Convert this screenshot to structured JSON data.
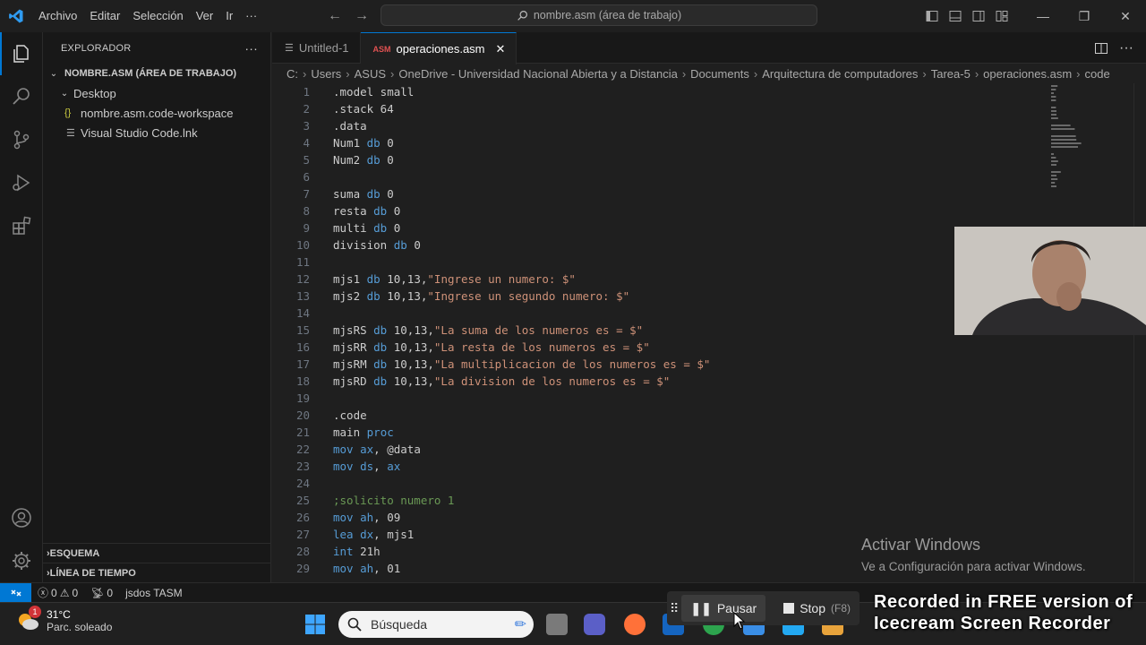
{
  "titlebar": {
    "menu": [
      "Archivo",
      "Editar",
      "Selección",
      "Ver",
      "Ir",
      "···"
    ],
    "search": "nombre.asm (área de trabajo)"
  },
  "sidebar": {
    "title": "EXPLORADOR",
    "more": "···",
    "workspace": "NOMBRE.ASM (ÁREA DE TRABAJO)",
    "folder": "Desktop",
    "files": [
      {
        "icon": "{}",
        "name": "nombre.asm.code-workspace"
      },
      {
        "icon": "",
        "name": "Visual Studio Code.lnk"
      }
    ],
    "outline": "ESQUEMA",
    "timeline": "LÍNEA DE TIEMPO"
  },
  "tabs": [
    {
      "label": "Untitled-1"
    },
    {
      "label": "operaciones.asm",
      "icon": "ASM"
    }
  ],
  "breadcrumb": [
    "C:",
    "Users",
    "ASUS",
    "OneDrive - Universidad Nacional Abierta y a Distancia",
    "Documents",
    "Arquitectura de computadores",
    "Tarea-5",
    "operaciones.asm",
    "code"
  ],
  "code": {
    "lines": [
      {
        "n": "1",
        "parts": [
          [
            "t",
            ".model small"
          ]
        ]
      },
      {
        "n": "2",
        "parts": [
          [
            "t",
            ".stack 64"
          ]
        ]
      },
      {
        "n": "3",
        "parts": [
          [
            "t",
            ".data"
          ]
        ]
      },
      {
        "n": "4",
        "parts": [
          [
            "t",
            "Num1 "
          ],
          [
            "kw",
            "db"
          ],
          [
            "t",
            " 0"
          ]
        ]
      },
      {
        "n": "5",
        "parts": [
          [
            "t",
            "Num2 "
          ],
          [
            "kw",
            "db"
          ],
          [
            "t",
            " 0"
          ]
        ]
      },
      {
        "n": "6",
        "parts": []
      },
      {
        "n": "7",
        "parts": [
          [
            "t",
            "suma "
          ],
          [
            "kw",
            "db"
          ],
          [
            "t",
            " 0"
          ]
        ]
      },
      {
        "n": "8",
        "parts": [
          [
            "t",
            "resta "
          ],
          [
            "kw",
            "db"
          ],
          [
            "t",
            " 0"
          ]
        ]
      },
      {
        "n": "9",
        "parts": [
          [
            "t",
            "multi "
          ],
          [
            "kw",
            "db"
          ],
          [
            "t",
            " 0"
          ]
        ]
      },
      {
        "n": "10",
        "parts": [
          [
            "t",
            "division "
          ],
          [
            "kw",
            "db"
          ],
          [
            "t",
            " 0"
          ]
        ]
      },
      {
        "n": "11",
        "parts": []
      },
      {
        "n": "12",
        "parts": [
          [
            "t",
            "mjs1 "
          ],
          [
            "kw",
            "db"
          ],
          [
            "t",
            " 10,13,"
          ],
          [
            "str",
            "\"Ingrese un numero: $\""
          ]
        ]
      },
      {
        "n": "13",
        "parts": [
          [
            "t",
            "mjs2 "
          ],
          [
            "kw",
            "db"
          ],
          [
            "t",
            " 10,13,"
          ],
          [
            "str",
            "\"Ingrese un segundo numero: $\""
          ]
        ]
      },
      {
        "n": "14",
        "parts": []
      },
      {
        "n": "15",
        "parts": [
          [
            "t",
            "mjsRS "
          ],
          [
            "kw",
            "db"
          ],
          [
            "t",
            " 10,13,"
          ],
          [
            "str",
            "\"La suma de los numeros es = $\""
          ]
        ]
      },
      {
        "n": "16",
        "parts": [
          [
            "t",
            "mjsRR "
          ],
          [
            "kw",
            "db"
          ],
          [
            "t",
            " 10,13,"
          ],
          [
            "str",
            "\"La resta de los numeros es = $\""
          ]
        ]
      },
      {
        "n": "17",
        "parts": [
          [
            "t",
            "mjsRM "
          ],
          [
            "kw",
            "db"
          ],
          [
            "t",
            " 10,13,"
          ],
          [
            "str",
            "\"La multiplicacion de los numeros es = $\""
          ]
        ]
      },
      {
        "n": "18",
        "parts": [
          [
            "t",
            "mjsRD "
          ],
          [
            "kw",
            "db"
          ],
          [
            "t",
            " 10,13,"
          ],
          [
            "str",
            "\"La division de los numeros es = $\""
          ]
        ]
      },
      {
        "n": "19",
        "parts": []
      },
      {
        "n": "20",
        "parts": [
          [
            "t",
            ".code"
          ]
        ]
      },
      {
        "n": "21",
        "parts": [
          [
            "t",
            "main "
          ],
          [
            "kw",
            "proc"
          ]
        ]
      },
      {
        "n": "22",
        "parts": [
          [
            "kw",
            "mov"
          ],
          [
            "t",
            " "
          ],
          [
            "kw",
            "ax"
          ],
          [
            "t",
            ", @data"
          ]
        ]
      },
      {
        "n": "23",
        "parts": [
          [
            "kw",
            "mov"
          ],
          [
            "t",
            " "
          ],
          [
            "kw",
            "ds"
          ],
          [
            "t",
            ", "
          ],
          [
            "kw",
            "ax"
          ]
        ]
      },
      {
        "n": "24",
        "parts": []
      },
      {
        "n": "25",
        "parts": [
          [
            "com",
            ";solicito numero 1"
          ]
        ]
      },
      {
        "n": "26",
        "parts": [
          [
            "kw",
            "mov"
          ],
          [
            "t",
            " "
          ],
          [
            "kw",
            "ah"
          ],
          [
            "t",
            ", 09"
          ]
        ]
      },
      {
        "n": "27",
        "parts": [
          [
            "kw",
            "lea"
          ],
          [
            "t",
            " "
          ],
          [
            "kw",
            "dx"
          ],
          [
            "t",
            ", mjs1"
          ]
        ]
      },
      {
        "n": "28",
        "parts": [
          [
            "kw",
            "int"
          ],
          [
            "t",
            " 21h"
          ]
        ]
      },
      {
        "n": "29",
        "parts": [
          [
            "kw",
            "mov"
          ],
          [
            "t",
            " "
          ],
          [
            "kw",
            "ah"
          ],
          [
            "t",
            ", 01"
          ]
        ]
      }
    ]
  },
  "activate_windows": {
    "title": "Activar Windows",
    "subtitle": "Ve a Configuración para activar Windows."
  },
  "statusbar": {
    "errors": "0",
    "warnings": "0",
    "ports": "0",
    "emulator": "jsdos TASM"
  },
  "taskbar": {
    "temp": "31°C",
    "condition": "Parc. soleado",
    "weather_badge": "1",
    "search": "Búsqueda"
  },
  "recorder": {
    "pause": "Pausar",
    "stop": "Stop",
    "shortcut": "(F8)",
    "watermark_1": "Recorded in FREE version of",
    "watermark_2": "Icecream Screen Recorder"
  },
  "colors": {
    "accent": "#0078d4",
    "keyword": "#569cd6",
    "string": "#ce9178",
    "comment": "#6a9955"
  }
}
